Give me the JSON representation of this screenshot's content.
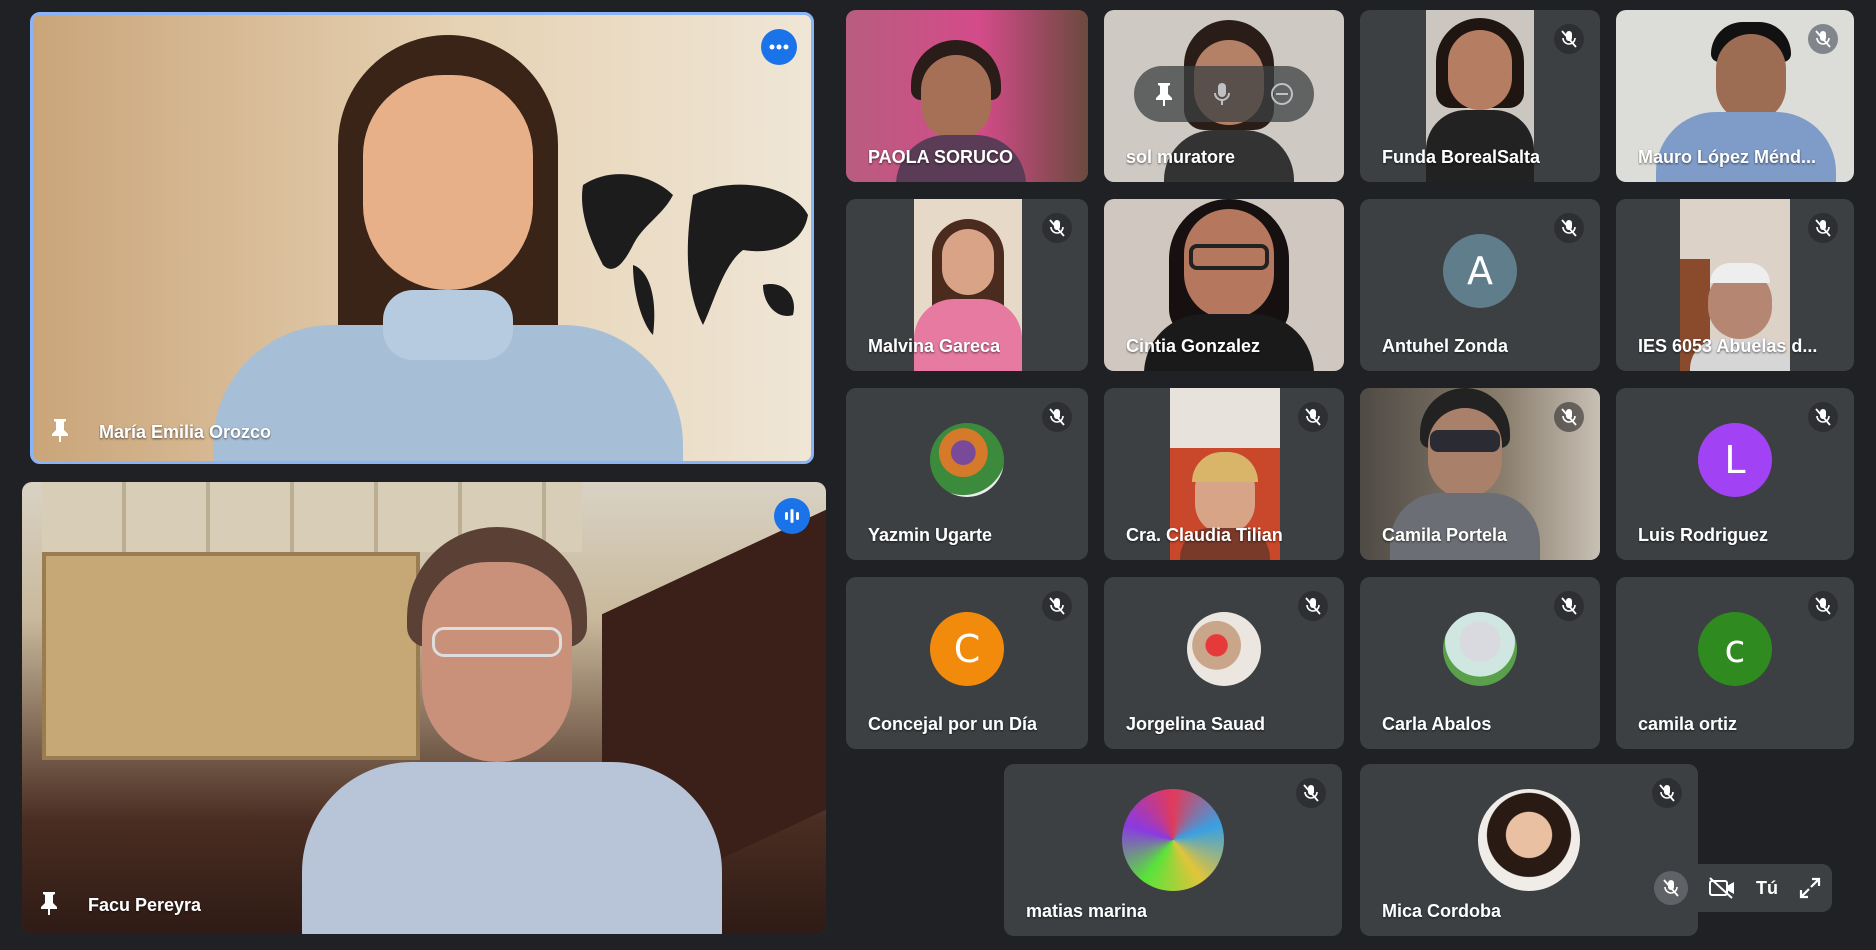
{
  "main_tiles": [
    {
      "name": "María Emilia Orozco"
    },
    {
      "name": "Facu Pereyra"
    }
  ],
  "tiles": [
    {
      "name": "PAOLA SORUCO"
    },
    {
      "name": "sol muratore"
    },
    {
      "name": "Funda BorealSalta"
    },
    {
      "name": "Mauro López Ménd..."
    },
    {
      "name": "Malvina Gareca"
    },
    {
      "name": "Cintia Gonzalez"
    },
    {
      "name": "Antuhel Zonda",
      "initial": "A"
    },
    {
      "name": "IES 6053 Abuelas d..."
    },
    {
      "name": "Yazmin Ugarte"
    },
    {
      "name": "Cra. Claudia Tilian"
    },
    {
      "name": "Camila Portela"
    },
    {
      "name": "Luis Rodriguez",
      "initial": "L"
    },
    {
      "name": "Concejal por un Día",
      "initial": "C"
    },
    {
      "name": "Jorgelina Sauad"
    },
    {
      "name": "Carla Abalos"
    },
    {
      "name": "camila ortiz",
      "initial": "c"
    },
    {
      "name": "matias marina"
    },
    {
      "name": "Mica Cordoba"
    }
  ],
  "self_view": {
    "label": "Tú"
  },
  "colors": {
    "background": "#202124",
    "tile": "#3c4043",
    "active_border": "#8ab4f8",
    "accent_blue": "#1a73e8",
    "avatar_slate": "#5f7d8a",
    "avatar_purple": "#a142f4",
    "avatar_orange": "#f28b0c",
    "avatar_green": "#2f8a1f"
  }
}
